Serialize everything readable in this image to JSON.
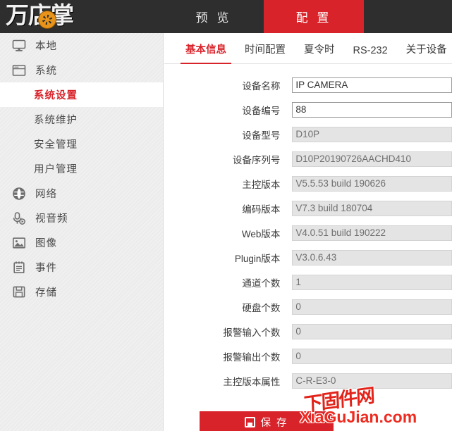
{
  "header": {
    "logo_text": "万店掌",
    "logo_icon": "camera-aperture-icon",
    "nav": [
      {
        "label": "预 览",
        "active": false
      },
      {
        "label": "配 置",
        "active": true
      }
    ],
    "accent_color": "#d8232a",
    "bar_color": "#2e2e2e"
  },
  "sidebar": {
    "background_color": "#ececec",
    "items": [
      {
        "label": "本地",
        "icon": "monitor-icon",
        "type": "top",
        "active": false
      },
      {
        "label": "系统",
        "icon": "window-icon",
        "type": "top",
        "active": false
      },
      {
        "label": "系统设置",
        "icon": "",
        "type": "sub",
        "active": true
      },
      {
        "label": "系统维护",
        "icon": "",
        "type": "sub",
        "active": false
      },
      {
        "label": "安全管理",
        "icon": "",
        "type": "sub",
        "active": false
      },
      {
        "label": "用户管理",
        "icon": "",
        "type": "sub",
        "active": false
      },
      {
        "label": "网络",
        "icon": "globe-icon",
        "type": "top",
        "active": false
      },
      {
        "label": "视音频",
        "icon": "microphone-icon",
        "type": "top",
        "active": false
      },
      {
        "label": "图像",
        "icon": "picture-icon",
        "type": "top",
        "active": false
      },
      {
        "label": "事件",
        "icon": "notepad-icon",
        "type": "top",
        "active": false
      },
      {
        "label": "存储",
        "icon": "floppy-disk-icon",
        "type": "top",
        "active": false
      }
    ]
  },
  "main": {
    "tabs": [
      {
        "label": "基本信息",
        "active": true
      },
      {
        "label": "时间配置",
        "active": false
      },
      {
        "label": "夏令时",
        "active": false
      },
      {
        "label": "RS-232",
        "active": false
      },
      {
        "label": "关于设备",
        "active": false
      }
    ],
    "fields": [
      {
        "label": "设备名称",
        "value": "IP CAMERA",
        "readonly": false
      },
      {
        "label": "设备编号",
        "value": "88",
        "readonly": false
      },
      {
        "label": "设备型号",
        "value": "D10P",
        "readonly": true
      },
      {
        "label": "设备序列号",
        "value": "D10P20190726AACHD410",
        "readonly": true
      },
      {
        "label": "主控版本",
        "value": "V5.5.53 build 190626",
        "readonly": true
      },
      {
        "label": "编码版本",
        "value": "V7.3 build 180704",
        "readonly": true
      },
      {
        "label": "Web版本",
        "value": "V4.0.51 build 190222",
        "readonly": true
      },
      {
        "label": "Plugin版本",
        "value": "V3.0.6.43",
        "readonly": true
      },
      {
        "label": "通道个数",
        "value": "1",
        "readonly": true
      },
      {
        "label": "硬盘个数",
        "value": "0",
        "readonly": true
      },
      {
        "label": "报警输入个数",
        "value": "0",
        "readonly": true
      },
      {
        "label": "报警输出个数",
        "value": "0",
        "readonly": true
      },
      {
        "label": "主控版本属性",
        "value": "C-R-E3-0",
        "readonly": true
      }
    ],
    "save_button": {
      "label": "保 存",
      "icon": "save-icon"
    }
  },
  "watermark": {
    "chinese": "下固件网",
    "english": "XiaGuJian.com",
    "color": "#ee2b20"
  }
}
